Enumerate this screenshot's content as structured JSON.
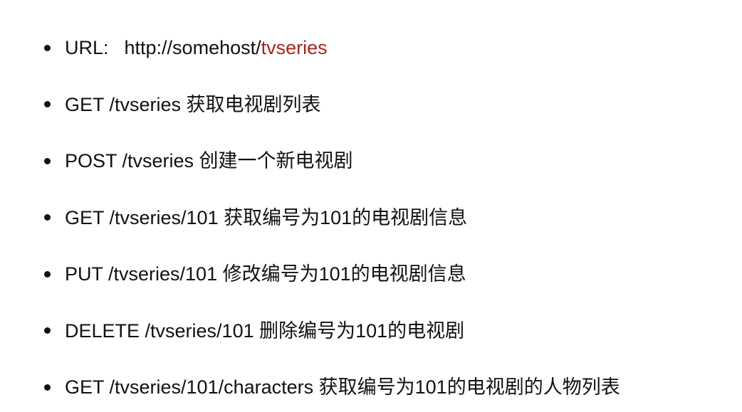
{
  "slide": {
    "items": [
      {
        "label": "URL:",
        "host": "http://somehost/",
        "resource": "tvseries"
      },
      {
        "text": "GET /tvseries 获取电视剧列表"
      },
      {
        "text": "POST /tvseries 创建一个新电视剧"
      },
      {
        "text": "GET /tvseries/101 获取编号为101的电视剧信息"
      },
      {
        "text": "PUT /tvseries/101 修改编号为101的电视剧信息"
      },
      {
        "text": "DELETE /tvseries/101 删除编号为101的电视剧"
      },
      {
        "text": "GET /tvseries/101/characters 获取编号为101的电视剧的人物列表"
      }
    ]
  },
  "colors": {
    "text": "#111111",
    "accent": "#a8251e",
    "background": "#ffffff"
  },
  "icons": {
    "bullet": "bullet-dot-icon"
  }
}
